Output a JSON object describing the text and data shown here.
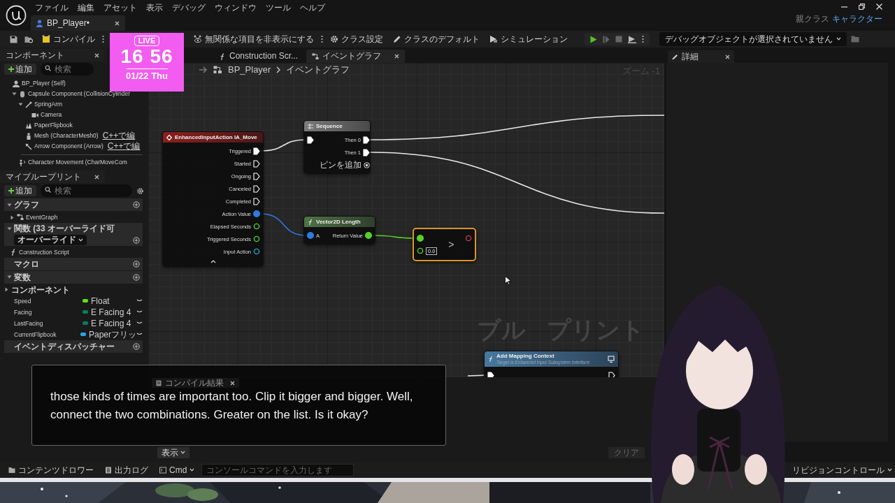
{
  "menu": [
    "ファイル",
    "編集",
    "アセット",
    "表示",
    "デバッグ",
    "ウィンドウ",
    "ツール",
    "ヘルプ"
  ],
  "document_tab": {
    "label": "BP_Player•"
  },
  "parent_class": {
    "label": "親クラス",
    "value": "キャラクター"
  },
  "toolbar": {
    "compile": "コンパイル",
    "buttons": [
      {
        "kind": "hide",
        "label": "無関係な項目を非表示にする",
        "menu": true
      },
      {
        "kind": "settings",
        "label": "クラス設定",
        "menu": false
      },
      {
        "kind": "defaults",
        "label": "クラスのデフォルト",
        "menu": false
      },
      {
        "kind": "simulation",
        "label": "シミュレーション",
        "menu": false
      }
    ],
    "debug_object": "デバッグオブジェクトが選択されていません"
  },
  "live_clock": {
    "badge": "LIVE",
    "time": "16 56",
    "date": "01/22 Thu"
  },
  "components_panel": {
    "title": "コンポーネント",
    "add": "追加",
    "search_placeholder": "検索",
    "tree": [
      {
        "label": "BP_Player (Self)",
        "kind": "self",
        "children": [
          {
            "label": "Capsule Component (CollisionCylinder",
            "kind": "capsule",
            "expanded": true,
            "children": [
              {
                "label": "SpringArm",
                "kind": "springarm",
                "expanded": true,
                "children": [
                  {
                    "label": "Camera",
                    "kind": "camera"
                  }
                ]
              },
              {
                "label": "PaperFlipbook",
                "kind": "flipbook"
              },
              {
                "label": "Mesh (CharacterMesh0)",
                "kind": "mesh",
                "link": "C++で編"
              },
              {
                "label": "Arrow Component (Arrow)",
                "kind": "arrow",
                "link": "C++で編"
              }
            ]
          }
        ]
      }
    ],
    "extra": [
      {
        "label": "Character Movement (CharMoveCom",
        "kind": "movement"
      }
    ]
  },
  "my_blueprint": {
    "title": "マイブループリント",
    "add": "追加",
    "search_placeholder": "検索",
    "sections": [
      {
        "title": "グラフ",
        "expanded": true,
        "items": [
          {
            "label": "EventGraph",
            "kind": "graph",
            "expanded": false
          }
        ]
      },
      {
        "title": "関数 (33 オーバーライド可",
        "expanded": true,
        "override": "オーバーライド",
        "items": [
          {
            "label": "Construction Script",
            "kind": "function"
          }
        ]
      },
      {
        "title": "マクロ"
      },
      {
        "title": "変数",
        "expanded": true,
        "items": [
          {
            "label": "コンポーネント",
            "kind": "category",
            "expanded": false
          },
          {
            "label": "Speed",
            "kind": "variable",
            "type": "Float",
            "color": "#5ee01e"
          },
          {
            "label": "Facing",
            "kind": "variable",
            "type": "E Facing 4",
            "color": "#0f7a5c"
          },
          {
            "label": "LastFacing",
            "kind": "variable",
            "type": "E Facing 4",
            "color": "#0f7a5c"
          },
          {
            "label": "CurrentFlipbook",
            "kind": "variable",
            "type": "Paperフリッ",
            "color": "#27a7e6"
          }
        ]
      },
      {
        "title": "イベントディスパッチャー"
      }
    ]
  },
  "graph_tabs": [
    {
      "label": "Construction Scr...",
      "kind": "function",
      "selected": false
    },
    {
      "label": "イベントグラフ",
      "kind": "graph",
      "selected": true
    }
  ],
  "breadcrumb": [
    "BP_Player",
    "イベントグラフ"
  ],
  "zoom": "ズーム -1",
  "watermark": [
    "ブル",
    "プリント"
  ],
  "nodes": [
    {
      "kind": "event",
      "title": "EnhancedInputAction IA_Move",
      "selected": false,
      "outputs": [
        {
          "label": "Triggered",
          "kind": "exec",
          "connected": true
        },
        {
          "label": "Started",
          "kind": "exec",
          "connected": false
        },
        {
          "label": "Ongoing",
          "kind": "exec",
          "connected": false
        },
        {
          "label": "Canceled",
          "kind": "exec",
          "connected": false
        },
        {
          "label": "Completed",
          "kind": "exec",
          "connected": false
        },
        {
          "label": "Action Value",
          "kind": "vector",
          "connected": true
        },
        {
          "label": "Elapsed Seconds",
          "kind": "float",
          "connected": false
        },
        {
          "label": "Triggered Seconds",
          "kind": "float",
          "connected": false
        },
        {
          "label": "Input Action",
          "kind": "object",
          "connected": false
        }
      ]
    },
    {
      "kind": "sequence",
      "title": "Sequence",
      "selected": false,
      "add_pin": "ピンを追加",
      "inputs": [
        {
          "kind": "exec",
          "connected": true
        }
      ],
      "outputs": [
        {
          "label": "Then 0",
          "kind": "exec",
          "connected": true
        },
        {
          "label": "Then 1",
          "kind": "exec",
          "connected": true
        }
      ]
    },
    {
      "kind": "function",
      "title": "Vector2D Length",
      "selected": false,
      "inputs": [
        {
          "label": "A",
          "kind": "vector",
          "connected": true
        }
      ],
      "outputs": [
        {
          "label": "Return Value",
          "kind": "float",
          "connected": true
        }
      ]
    },
    {
      "kind": "compare",
      "symbol": ">",
      "selected": true,
      "inputs": [
        {
          "kind": "float",
          "connected": true
        },
        {
          "kind": "float",
          "connected": false,
          "value": "0.0"
        }
      ],
      "outputs": [
        {
          "kind": "bool",
          "connected": false
        }
      ]
    },
    {
      "kind": "call",
      "title": "Add Mapping Context",
      "subtitle": "Target is Enhanced Input Subsystem Interface",
      "selected": false,
      "inputs": [
        {
          "kind": "exec",
          "connected": true
        }
      ],
      "outputs": [
        {
          "kind": "exec",
          "connected": false
        }
      ]
    }
  ],
  "compile_panel": {
    "tab": "コンパイル結果",
    "view": "表示",
    "clear": {
      "label": "クリア",
      "disabled": true
    }
  },
  "details_panel": {
    "tab": "詳細"
  },
  "subtitle": "those kinds of times are important too. Clip it bigger and bigger. Well, connect the two combinations. Greater on the list. Is it okay?",
  "status_bar": {
    "content_drawer": "コンテンツドロワー",
    "output_log": "出力ログ",
    "cmd": "Cmd",
    "console_placeholder": "コンソールコマンドを入力します",
    "revision_control": "リビジョンコントロール"
  }
}
